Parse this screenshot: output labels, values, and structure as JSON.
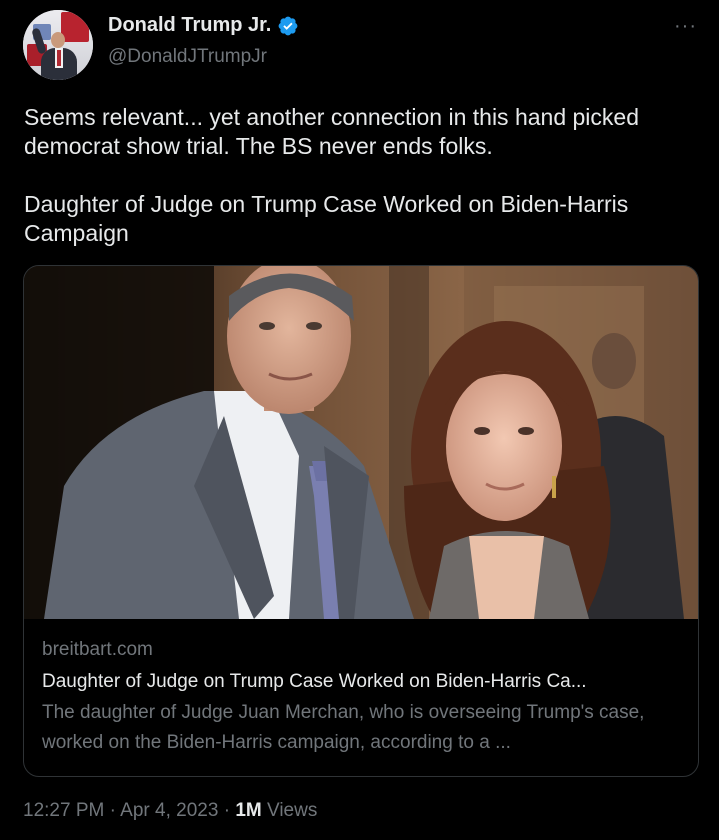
{
  "author": {
    "display_name": "Donald Trump Jr.",
    "handle": "@DonaldJTrumpJr",
    "verified_color": "#1d9bf0"
  },
  "more_label": "···",
  "tweet": {
    "text_line1": "Seems relevant... yet another connection in this hand picked democrat show trial. The BS never ends folks.",
    "text_line2": "Daughter of Judge on Trump Case Worked on Biden-Harris Campaign"
  },
  "card": {
    "domain": "breitbart.com",
    "title": "Daughter of Judge on Trump Case Worked on Biden-Harris Ca...",
    "description": "The daughter of Judge Juan Merchan, who is overseeing Trump's case, worked on the Biden-Harris campaign, according to a ..."
  },
  "footer": {
    "time": "12:27 PM",
    "separator": " · ",
    "date": "Apr 4, 2023",
    "views_count": "1M",
    "views_label": " Views"
  },
  "colors": {
    "background": "#000000",
    "text_primary": "#e7e9ea",
    "text_secondary": "#71767b",
    "border": "#2f3336",
    "accent": "#1d9bf0"
  }
}
